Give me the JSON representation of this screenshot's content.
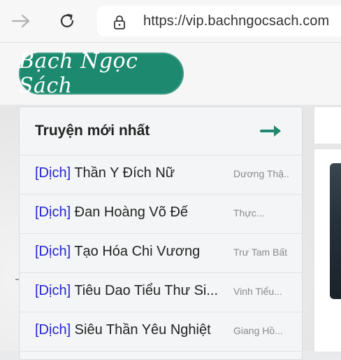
{
  "browser": {
    "url": "https://vip.bachngocsach.com"
  },
  "site": {
    "logo_text": "Bạch Ngọc Sách"
  },
  "latest": {
    "title": "Truyện mới nhất",
    "items": [
      {
        "tag": "[Dịch]",
        "title": " Thần Y Đích Nữ",
        "author": "Dương Thậ..."
      },
      {
        "tag": "[Dịch]",
        "title": " Đan Hoàng Võ Đế",
        "author": "Thực..."
      },
      {
        "tag": "[Dịch]",
        "title": " Tạo Hóa Chi Vương",
        "author": "Trư Tam Bất"
      },
      {
        "tag": "[Dịch]",
        "title": " Tiêu Dao Tiểu Thư Si...",
        "author": "Vinh Tiểu..."
      },
      {
        "tag": "[Dịch]",
        "title": " Siêu Thần Yêu Nghiệt",
        "author": "Giang Hồ..."
      }
    ]
  },
  "colors": {
    "brand": "#1d8a6f",
    "tag": "#2323d8",
    "arrow": "#1d8a6f"
  }
}
